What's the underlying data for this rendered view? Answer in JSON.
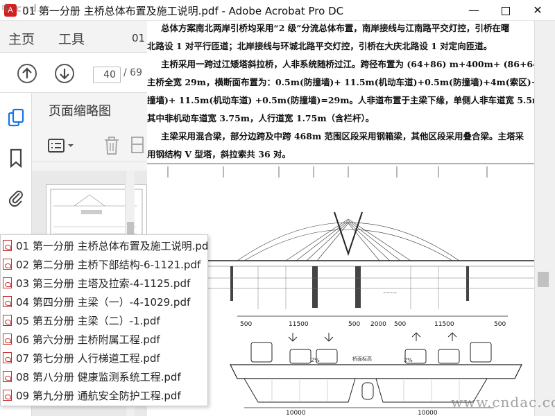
{
  "window": {
    "title": "01 第一分册 主桥总体布置及施工说明.pdf - Adobe Acrobat Pro DC",
    "watermark_top_left": "中 cnd..."
  },
  "menu": {
    "home": "主页",
    "tools": "工具",
    "doc_tab_fragment": "01"
  },
  "navigation": {
    "current_page": "40",
    "total_pages": "/ 69"
  },
  "panel": {
    "title": "页面缩略图"
  },
  "document": {
    "lines": [
      "总体方案南北两岸引桥均采用“2 级”分流总体布置，南岸接线与江南路平交灯控，引桥在曙",
      "北路设 1 对平行匝道；北岸接线与环城北路平交灯控，引桥在大庆北路设 1 对定向匝道。",
      "主桥采用一跨过江矮塔斜拉桥，人非系统随桥过江。跨径布置为 (64+86) m+400m+ (86+64) m，",
      "主桥全宽 29m，横断面布置为：0.5m(防撞墙)+ 11.5m(机动车道)+0.5m(防撞墙)+4m(索区)+ 0.5m(防",
      "撞墙)+ 11.5m(机动车道) +0.5m(防撞墙)=29m。人非道布置于主梁下缘，单侧人非车道宽 5.5m，",
      "其中非机动车道宽 3.75m，人行道宽 1.75m（含栏杆）。",
      "主梁采用混合梁，部分边跨及中跨 468m 范围区段采用钢箱梁，其他区段采用叠合梁。主塔采",
      "用钢结构 V 型塔，斜拉索共 36 对。"
    ],
    "drawing_dims": [
      "500",
      "11500",
      "500",
      "2000",
      "500",
      "11500",
      "500"
    ],
    "bottom_dims": [
      "10000",
      "10000"
    ],
    "drawing_label": "桥面标高",
    "slope_left": "2%",
    "slope_right": "2%",
    "watermark": "www.cndac.com"
  },
  "file_list": [
    "01 第一分册 主桥总体布置及施工说明.pd",
    "02 第二分册 主桥下部结构-6-1121.pdf",
    "03 第三分册 主塔及拉索-4-1125.pdf",
    "04 第四分册 主梁（一）-4-1029.pdf",
    "05 第五分册 主梁（二）-1.pdf",
    "06 第六分册 主桥附属工程.pdf",
    "07 第七分册 人行梯道工程.pdf",
    "08 第八分册 健康监测系统工程.pdf",
    "09 第九分册 通航安全防护工程.pdf"
  ]
}
